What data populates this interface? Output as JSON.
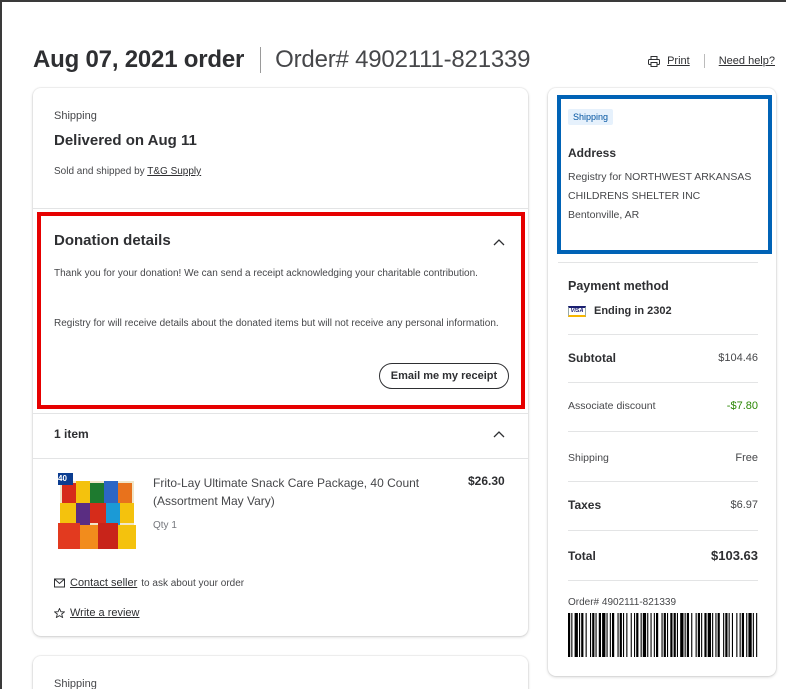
{
  "header": {
    "order_date": "Aug 07, 2021 order",
    "order_number": "Order# 4902111-821339",
    "print_label": "Print",
    "help_label": "Need help?"
  },
  "shipment": {
    "label": "Shipping",
    "status": "Delivered on Aug 11",
    "sold_by_prefix": "Sold and shipped by",
    "seller_name": "T&G Supply"
  },
  "donation": {
    "title": "Donation details",
    "text1": "Thank you for your donation! We can send a receipt acknowledging your charitable contribution.",
    "text2": "Registry for will receive details about the donated items but will not receive any personal information.",
    "button_label": "Email me my receipt"
  },
  "items": {
    "count_label": "1 item",
    "product": {
      "name": "Frito-Lay Ultimate Snack Care Package, 40 Count (Assortment May Vary)",
      "price": "$26.30",
      "qty": "Qty 1",
      "image_badge": "40"
    },
    "contact_seller": "Contact seller",
    "contact_suffix": "to ask about your order",
    "write_review": "Write a review"
  },
  "second_shipment": {
    "label": "Shipping"
  },
  "sidebar": {
    "shipping_pill": "Shipping",
    "address_title": "Address",
    "address_lines": "Registry for NORTHWEST ARKANSAS CHILDRENS SHELTER INC",
    "address_city": "Bentonville, AR",
    "payment_title": "Payment method",
    "card_brand": "VISA",
    "card_ending": "Ending in 2302",
    "subtotal_label": "Subtotal",
    "subtotal_value": "$104.46",
    "discount_label": "Associate discount",
    "discount_value": "-$7.80",
    "shipping_label": "Shipping",
    "shipping_value": "Free",
    "taxes_label": "Taxes",
    "taxes_value": "$6.97",
    "total_label": "Total",
    "total_value": "$103.63",
    "order_footer": "Order# 4902111-821339"
  },
  "colors": {
    "donation_highlight": "#e60000",
    "address_highlight": "#0063b6",
    "discount_green": "#2a8703",
    "pill_bg": "#e6f1fc"
  }
}
